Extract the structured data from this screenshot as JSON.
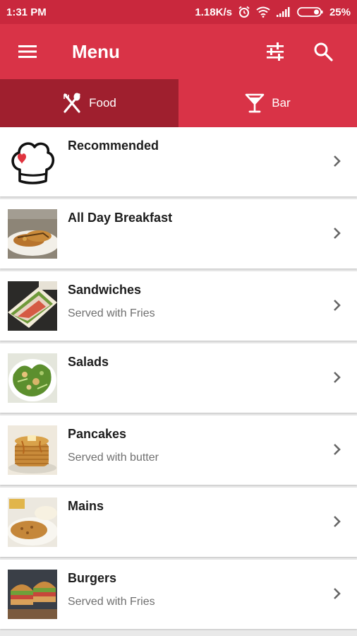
{
  "status_bar": {
    "time": "1:31 PM",
    "network_speed": "1.18K/s",
    "battery": "25%"
  },
  "app_bar": {
    "title": "Menu",
    "icons": [
      "menu-icon",
      "tune-icon",
      "search-icon"
    ]
  },
  "tabs": [
    {
      "label": "Food",
      "icon": "fork-knife-icon",
      "active": true
    },
    {
      "label": "Bar",
      "icon": "cocktail-glass-icon",
      "active": false
    }
  ],
  "categories": [
    {
      "name": "Recommended",
      "subtitle": "",
      "image": "chef-hat-icon"
    },
    {
      "name": "All Day Breakfast",
      "subtitle": "",
      "image": "breakfast-photo"
    },
    {
      "name": "Sandwiches",
      "subtitle": "Served with Fries",
      "image": "sandwich-photo"
    },
    {
      "name": "Salads",
      "subtitle": "",
      "image": "salad-photo"
    },
    {
      "name": "Pancakes",
      "subtitle": "Served with butter",
      "image": "pancakes-photo"
    },
    {
      "name": "Mains",
      "subtitle": "",
      "image": "mains-photo"
    },
    {
      "name": "Burgers",
      "subtitle": "Served with Fries",
      "image": "burger-photo"
    }
  ],
  "colors": {
    "status_bar": "#c9283d",
    "app_bar": "#d93347",
    "tab_active": "#9f1f2e",
    "background": "#e9e9e9"
  }
}
